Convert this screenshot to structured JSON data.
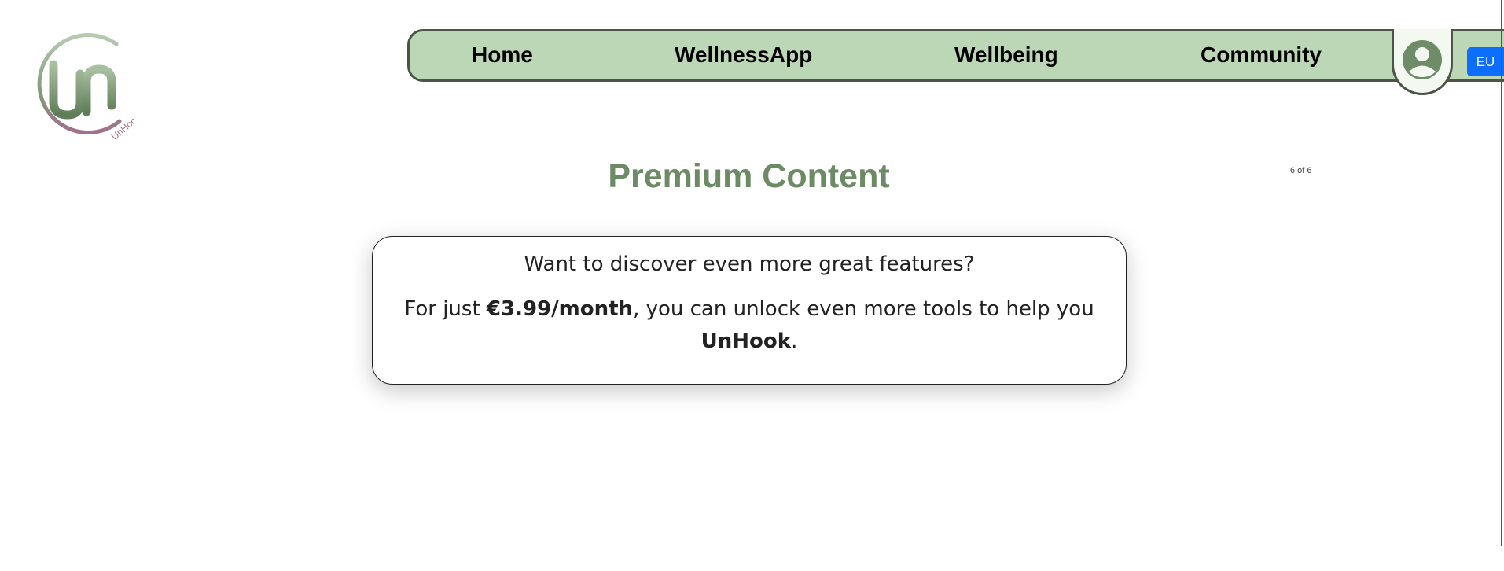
{
  "logo": {
    "text": "UnHook",
    "colors": {
      "ring": "#7f9a78",
      "ring_accent": "#a36f8e",
      "letters": "#6f8c68"
    }
  },
  "nav": {
    "items": [
      {
        "label": "Home"
      },
      {
        "label": "WellnessApp"
      },
      {
        "label": "Wellbeing"
      },
      {
        "label": "Community"
      }
    ],
    "profile_icon": "user-circle-icon",
    "language_label": "EU",
    "colors": {
      "bar": "#bcd7b6",
      "border": "#4a5548",
      "lang_button": "#0d6efd"
    }
  },
  "main": {
    "title": "Premium Content",
    "page_counter": "6 of 6",
    "card": {
      "question": "Want to discover even more great features?",
      "offer_prefix": "For just ",
      "price": "€3.99/month",
      "offer_middle": ", you can unlock even more tools to help you ",
      "brand": "UnHook",
      "offer_suffix": "."
    },
    "colors": {
      "title": "#6c8a63"
    }
  }
}
